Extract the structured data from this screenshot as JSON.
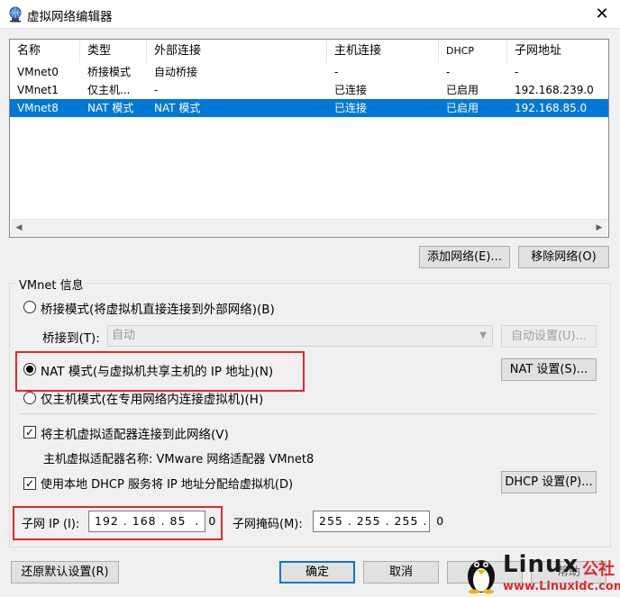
{
  "window": {
    "title": "虚拟网络编辑器",
    "close_glyph": "✕"
  },
  "table": {
    "headers": [
      "名称",
      "类型",
      "外部连接",
      "主机连接",
      "DHCP",
      "子网地址"
    ],
    "rows": [
      [
        "VMnet0",
        "桥接模式",
        "自动桥接",
        "-",
        "-",
        "-"
      ],
      [
        "VMnet1",
        "仅主机...",
        "-",
        "已连接",
        "已启用",
        "192.168.239.0"
      ],
      [
        "VMnet8",
        "NAT 模式",
        "NAT 模式",
        "已连接",
        "已启用",
        "192.168.85.0"
      ]
    ],
    "selected_row": 2
  },
  "buttons": {
    "add_network": "添加网络(E)...",
    "remove_network": "移除网络(O)",
    "auto_settings": "自动设置(U)...",
    "nat_settings": "NAT 设置(S)...",
    "dhcp_settings": "DHCP 设置(P)...",
    "restore_defaults": "还原默认设置(R)",
    "ok": "确定",
    "cancel": "取消",
    "help": "帮助"
  },
  "vmnet_info": {
    "legend": "VMnet 信息",
    "bridge_mode": "桥接模式(将虚拟机直接连接到外部网络)(B)",
    "bridge_to_label": "桥接到(T):",
    "bridge_to_value": "自动",
    "nat_mode": "NAT 模式(与虚拟机共享主机的 IP 地址)(N)",
    "host_only_mode": "仅主机模式(在专用网络内连接虚拟机)(H)",
    "selected_mode": "nat",
    "connect_host_adapter": "将主机虚拟适配器连接到此网络(V)",
    "connect_host_adapter_checked": true,
    "adapter_name": "主机虚拟适配器名称: VMware 网络适配器 VMnet8",
    "use_dhcp": "使用本地 DHCP 服务将 IP 地址分配给虚拟机(D)",
    "use_dhcp_checked": true,
    "subnet_ip_label": "子网 IP (I):",
    "subnet_ip": "192 . 168 . 85  .  0",
    "subnet_mask_label": "子网掩码(M):",
    "subnet_mask": "255 . 255 . 255 .  0"
  },
  "watermark": {
    "brand": "Linux",
    "brand_cn": "公社",
    "url": "www.Linuxidc.com"
  },
  "colors": {
    "selection": "#0078d7",
    "highlight_box": "#e0282e"
  }
}
